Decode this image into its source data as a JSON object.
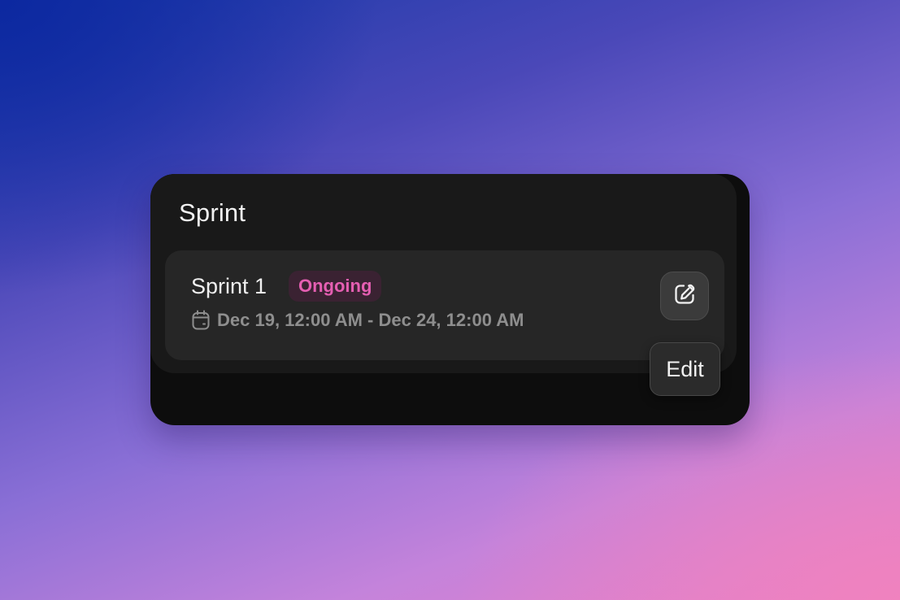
{
  "panel": {
    "title": "Sprint"
  },
  "sprint": {
    "name": "Sprint 1",
    "status": "Ongoing",
    "status_color": "#e55fb2",
    "date_range": "Dec 19, 12:00 AM - Dec 24, 12:00 AM",
    "date_icon": "calendar-icon"
  },
  "edit_action": {
    "icon": "edit-icon",
    "tooltip": "Edit"
  }
}
